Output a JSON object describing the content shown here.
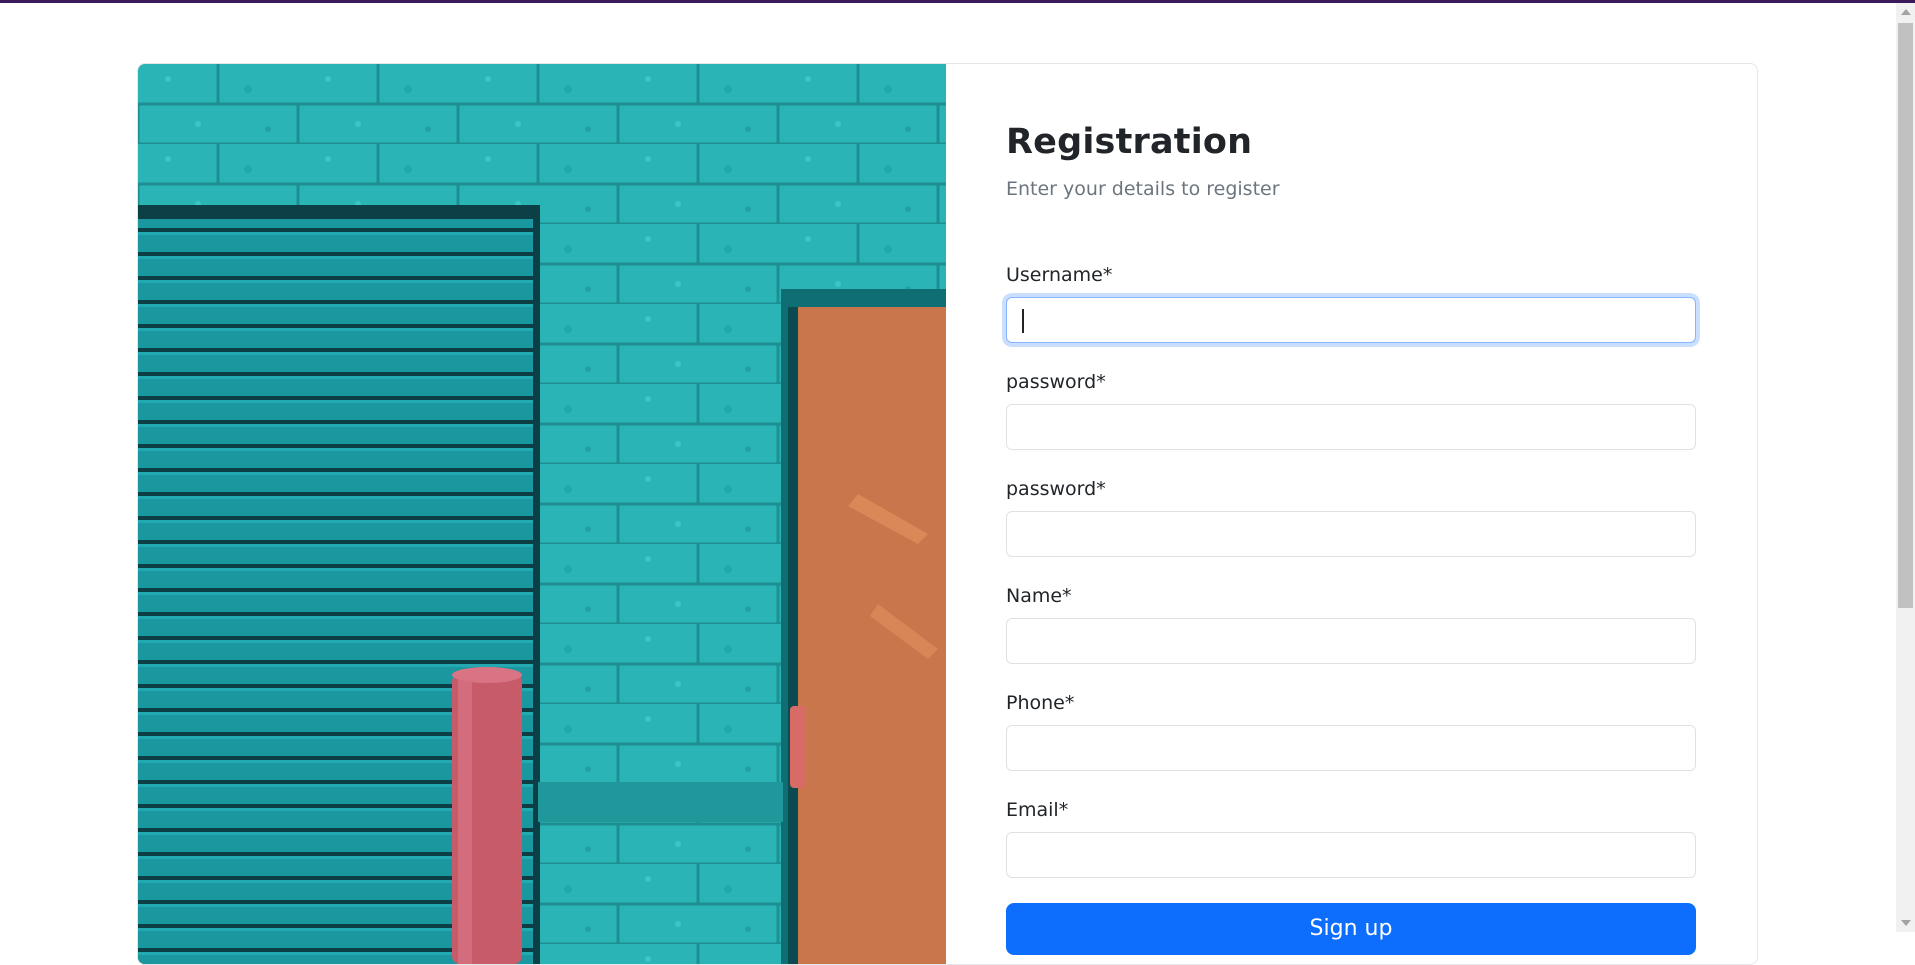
{
  "form": {
    "title": "Registration",
    "subtitle": "Enter your details to register",
    "fields": [
      {
        "label": "Username*",
        "value": "",
        "focused": true
      },
      {
        "label": "password*",
        "value": ""
      },
      {
        "label": "password*",
        "value": ""
      },
      {
        "label": "Name*",
        "value": ""
      },
      {
        "label": "Phone*",
        "value": ""
      },
      {
        "label": "Email*",
        "value": ""
      }
    ],
    "submit_label": "Sign up"
  },
  "colors": {
    "primary": "#0d6efd",
    "wall": "#2bb6b8",
    "door": "#c9764d",
    "shutter": "#1a8e96",
    "bollard": "#c75b6a"
  }
}
